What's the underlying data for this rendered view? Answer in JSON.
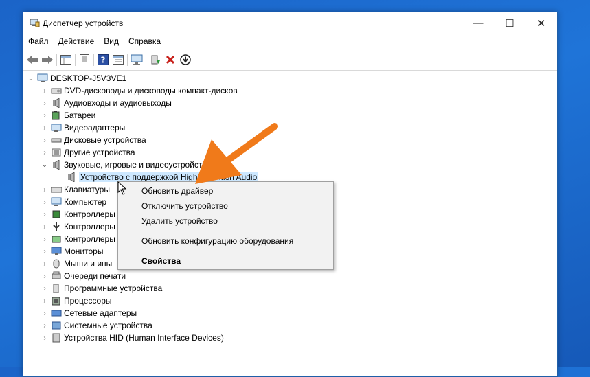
{
  "window": {
    "title": "Диспетчер устройств"
  },
  "window_controls": {
    "minimize": "—",
    "maximize": "☐",
    "close": "✕"
  },
  "menu": [
    "Файл",
    "Действие",
    "Вид",
    "Справка"
  ],
  "toolbar_icons": [
    "back-arrow-icon",
    "forward-arrow-icon",
    "properties-view-icon",
    "properties-sheet-icon",
    "help-icon",
    "details-icon",
    "monitor-scan-icon",
    "update-driver-icon",
    "remove-device-icon",
    "download-icon"
  ],
  "tree": {
    "root": "DESKTOP-J5V3VE1",
    "items": [
      {
        "label": "DVD-дисководы и дисководы компакт-дисков",
        "icon": "dvd-drive-icon",
        "expanded": false
      },
      {
        "label": "Аудиовходы и аудиовыходы",
        "icon": "speaker-icon",
        "expanded": false
      },
      {
        "label": "Батареи",
        "icon": "battery-icon",
        "expanded": false
      },
      {
        "label": "Видеоадаптеры",
        "icon": "display-adapter-icon",
        "expanded": false
      },
      {
        "label": "Дисковые устройства",
        "icon": "disk-drive-icon",
        "expanded": false
      },
      {
        "label": "Другие устройства",
        "icon": "unknown-device-icon",
        "expanded": false
      },
      {
        "label": "Звуковые, игровые и видеоустройства",
        "icon": "speaker-icon",
        "expanded": true
      },
      {
        "label": "Устройство с поддержкой High Definition Audio",
        "icon": "speaker-icon",
        "child": true,
        "selected": true
      },
      {
        "label": "Клавиатуры",
        "icon": "keyboard-icon",
        "expanded": false
      },
      {
        "label": "Компьютер",
        "icon": "computer-icon",
        "expanded": false
      },
      {
        "label": "Контроллеры",
        "icon": "controller-icon",
        "expanded": false
      },
      {
        "label": "Контроллеры",
        "icon": "usb-controller-icon",
        "expanded": false
      },
      {
        "label": "Контроллеры",
        "icon": "storage-controller-icon",
        "expanded": false
      },
      {
        "label": "Мониторы",
        "icon": "monitor-icon",
        "expanded": false
      },
      {
        "label": "Мыши и ины",
        "icon": "mouse-icon",
        "expanded": false
      },
      {
        "label": "Очереди печати",
        "icon": "printer-icon",
        "expanded": false
      },
      {
        "label": "Программные устройства",
        "icon": "software-device-icon",
        "expanded": false
      },
      {
        "label": "Процессоры",
        "icon": "processor-icon",
        "expanded": false
      },
      {
        "label": "Сетевые адаптеры",
        "icon": "network-adapter-icon",
        "expanded": false
      },
      {
        "label": "Системные устройства",
        "icon": "system-device-icon",
        "expanded": false
      },
      {
        "label": "Устройства HID (Human Interface Devices)",
        "icon": "hid-device-icon",
        "expanded": false
      }
    ]
  },
  "context_menu": {
    "items": [
      "Обновить драйвер",
      "Отключить устройство",
      "Удалить устройство",
      "Обновить конфигурацию оборудования",
      "Свойства"
    ]
  },
  "colors": {
    "accent_arrow": "#f07a1a",
    "selection": "#cde8ff",
    "desktop": "#1f74d8"
  }
}
